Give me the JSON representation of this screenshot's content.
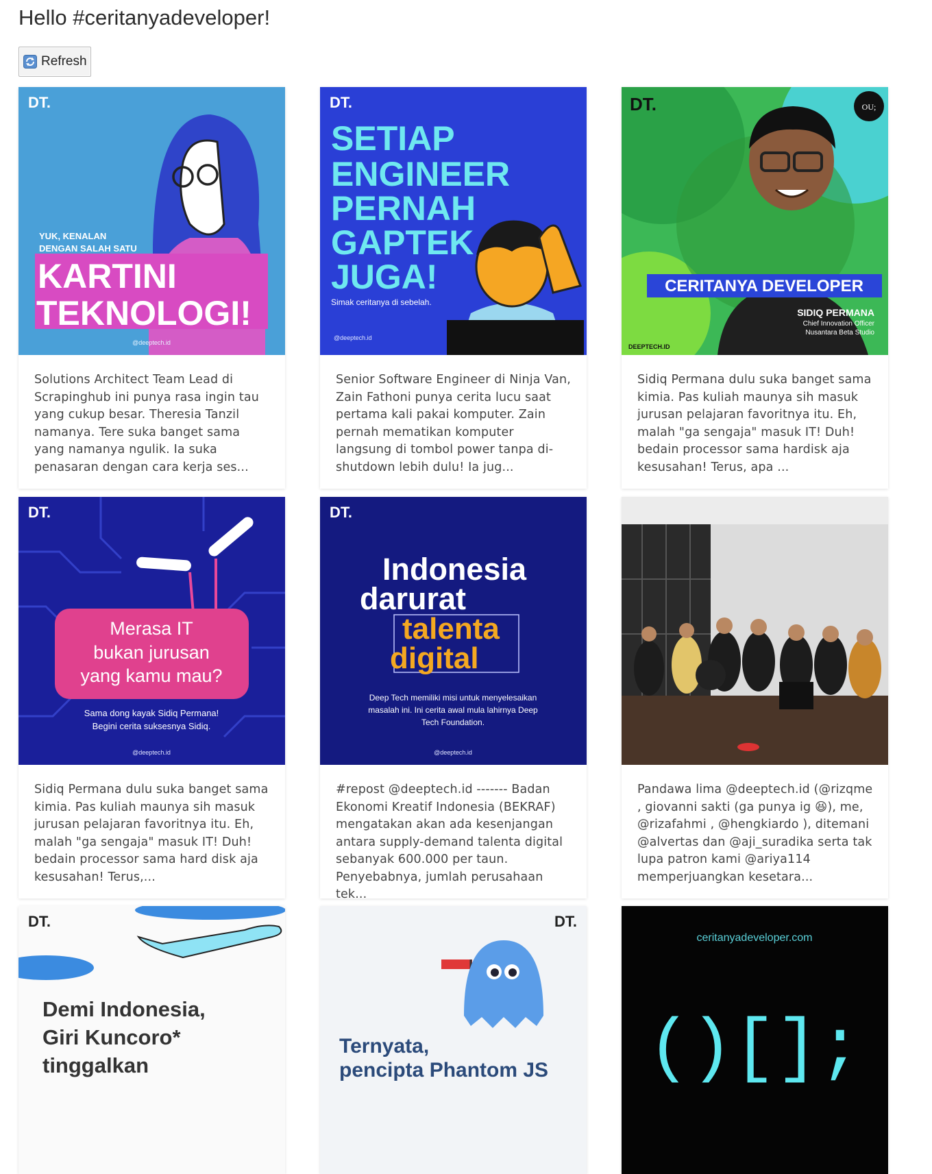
{
  "page": {
    "title": "Hello #ceritanyadeveloper!",
    "refresh_label": "Refresh"
  },
  "cards": [
    {
      "image_text": {
        "logo": "DT.",
        "line1": "YUK, KENALAN",
        "line2": "DENGAN SALAH SATU",
        "big1": "KARTINI",
        "big2": "TEKNOLOGI!",
        "handle": "@deeptech.id"
      },
      "caption": "Solutions Architect Team Lead di Scrapinghub ini punya rasa ingin tau yang cukup besar. Theresia Tanzil namanya.  Tere suka banget sama yang namanya ngulik. Ia suka penasaran dengan cara kerja ses..."
    },
    {
      "image_text": {
        "logo": "DT.",
        "l1": "SETIAP",
        "l2": "ENGINEER",
        "l3": "PERNAH",
        "l4": "GAPTEK",
        "l5": "JUGA!",
        "sub": "Simak ceritanya di sebelah.",
        "handle": "@deeptech.id"
      },
      "caption": "Senior Software Engineer di Ninja Van, Zain Fathoni punya cerita lucu saat pertama kali pakai komputer.  Zain pernah mematikan komputer langsung di tombol power tanpa di-shutdown lebih dulu! Ia jug..."
    },
    {
      "image_text": {
        "logo": "DT.",
        "banner": "CERITANYA DEVELOPER",
        "name": "SIDIQ PERMANA",
        "role1": "Chief Innovation Officer",
        "role2": "Nusantara Beta Studio",
        "corner": "DEEPTECH.ID",
        "badge": "OU;"
      },
      "caption": "Sidiq Permana dulu suka banget sama kimia. Pas kuliah maunya sih masuk jurusan pelajaran favoritnya itu. Eh, malah \"ga sengaja\" masuk IT! Duh! bedain processor sama hardisk aja kesusahan! Terus, apa ..."
    },
    {
      "image_text": {
        "logo": "DT.",
        "l1": "Merasa IT",
        "l2": "bukan jurusan",
        "l3": "yang kamu mau?",
        "s1": "Sama dong kayak Sidiq Permana!",
        "s2": "Begini cerita suksesnya Sidiq.",
        "handle": "@deeptech.id"
      },
      "caption": "Sidiq Permana dulu suka banget sama kimia. Pas kuliah maunya sih masuk jurusan pelajaran favoritnya itu. Eh, malah \"ga sengaja\" masuk IT! Duh! bedain processor sama hard disk aja kesusahan!  Terus,..."
    },
    {
      "image_text": {
        "logo": "DT.",
        "l1": "Indonesia",
        "l2": "darurat",
        "l3": "talenta",
        "l4": "digital",
        "s1": "Deep Tech memiliki misi untuk menyelesaikan",
        "s2": "masalah ini. Ini cerita awal mula lahirnya Deep",
        "s3": "Tech Foundation.",
        "handle": "@deeptech.id"
      },
      "caption": "#repost @deeptech.id ------- Badan Ekonomi Kreatif Indonesia (BEKRAF) mengatakan akan ada kesenjangan antara supply-demand talenta digital sebanyak 600.000 per taun. Penyebabnya, jumlah perusahaan tek..."
    },
    {
      "image_text": {},
      "caption": "Pandawa lima @deeptech.id (@rizqme , giovanni sakti (ga punya ig 😆), me, @rizafahmi , @hengkiardo ), ditemani @alvertas dan @aji_suradika serta tak lupa patron kami @ariya114 memperjuangkan kesetara..."
    },
    {
      "image_text": {
        "logo": "DT.",
        "l1": "Demi Indonesia,",
        "l2": "Giri Kuncoro*",
        "l3": "tinggalkan"
      },
      "caption": ""
    },
    {
      "image_text": {
        "logo": "DT.",
        "l1": "Ternyata,",
        "l2": "pencipta Phantom JS"
      },
      "caption": ""
    },
    {
      "image_text": {
        "site": "ceritanyadeveloper.com",
        "code": "()[];"
      },
      "caption": ""
    }
  ]
}
